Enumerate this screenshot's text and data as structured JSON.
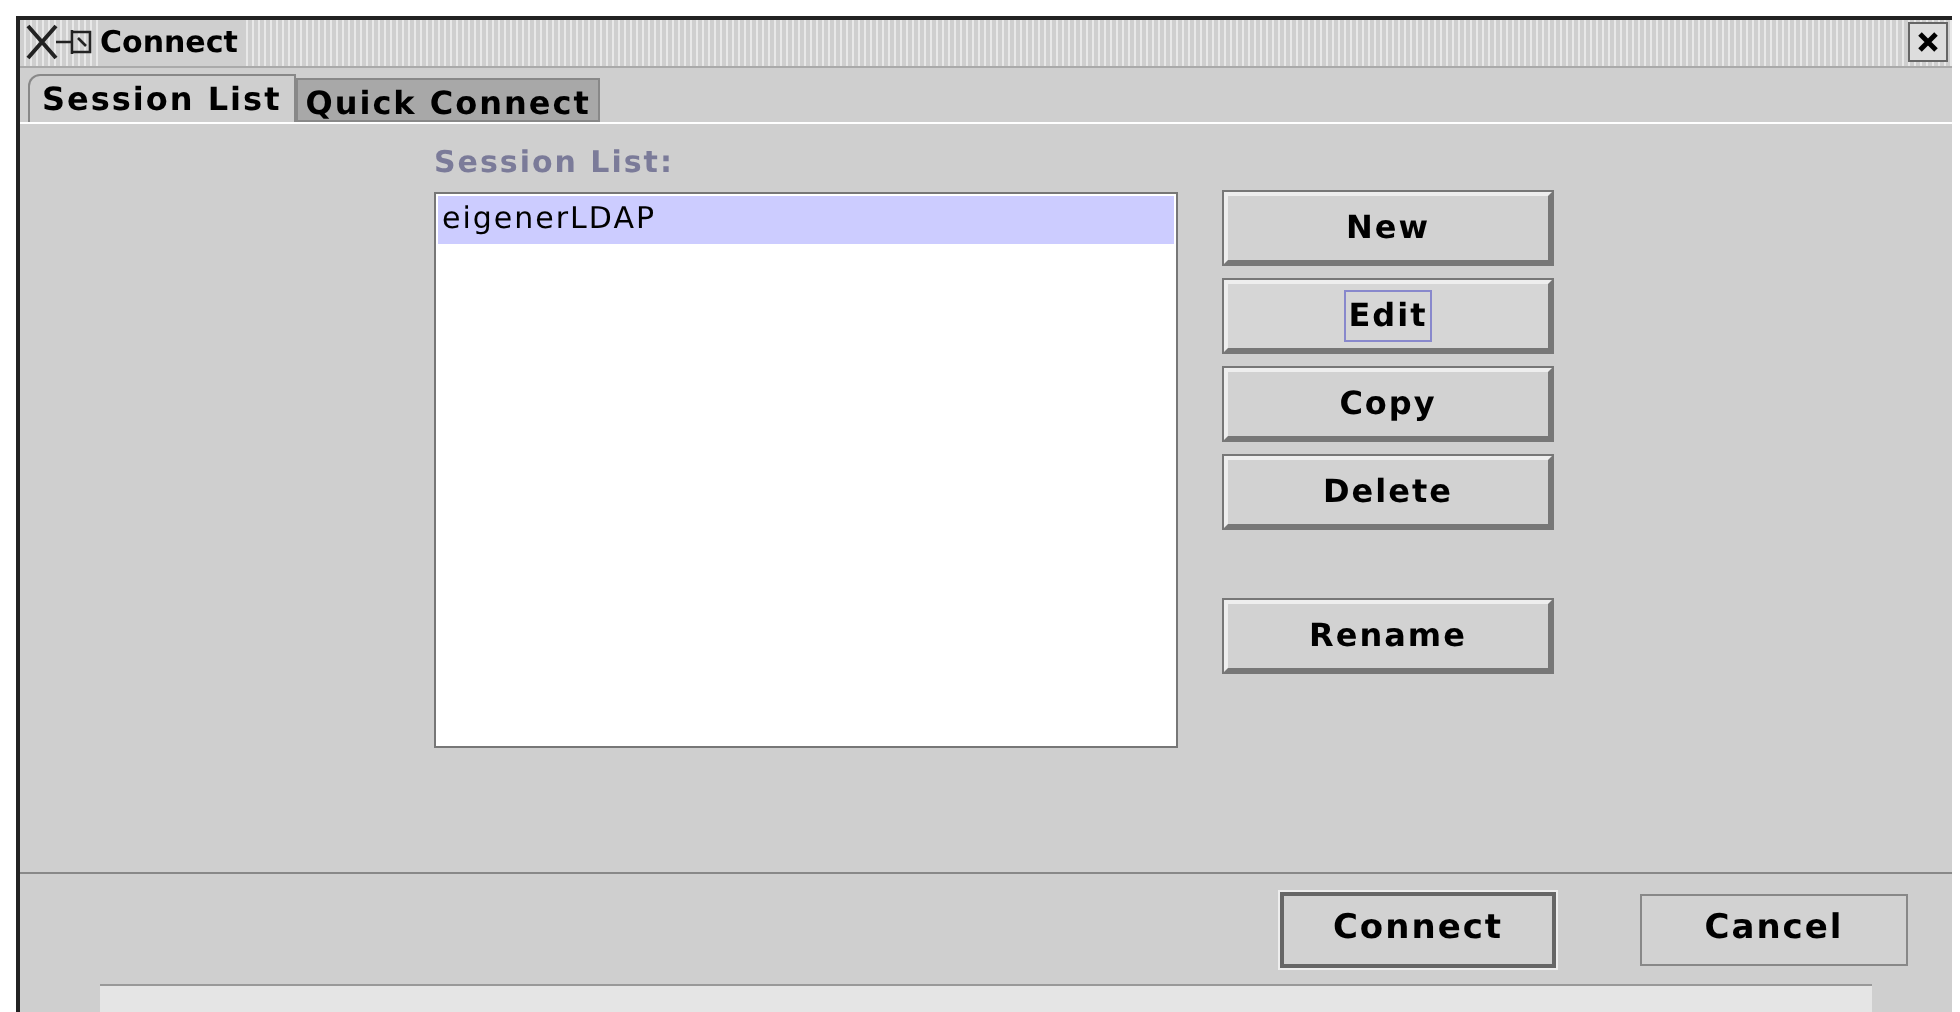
{
  "window": {
    "title": "Connect"
  },
  "tabs": [
    {
      "label": "Session List",
      "selected": true
    },
    {
      "label": "Quick Connect",
      "selected": false
    }
  ],
  "session_list": {
    "label": "Session List:",
    "items": [
      {
        "label": "eigenerLDAP",
        "selected": true
      }
    ]
  },
  "side_buttons": [
    {
      "label": "New",
      "focused": false
    },
    {
      "label": "Edit",
      "focused": true
    },
    {
      "label": "Copy",
      "focused": false
    },
    {
      "label": "Delete",
      "focused": false
    }
  ],
  "rename_button": {
    "label": "Rename"
  },
  "footer_buttons": [
    {
      "label": "Connect",
      "default": true
    },
    {
      "label": "Cancel",
      "default": false
    }
  ]
}
